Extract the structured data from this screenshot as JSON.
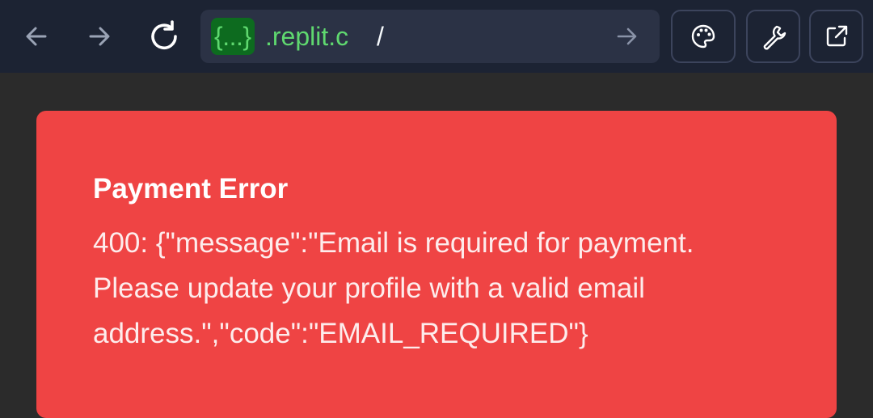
{
  "browser": {
    "url_badge": "{...}",
    "url_domain": ".replit.c",
    "url_path": "/",
    "icons": {
      "back": "arrow-left-icon",
      "forward": "arrow-right-icon",
      "reload": "reload-icon",
      "go": "arrow-right-icon",
      "theme": "palette-icon",
      "devtools": "wrench-icon",
      "open_external": "external-link-icon"
    }
  },
  "toast": {
    "title": "Payment Error",
    "message": "400: {\"message\":\"Email is required for payment. Please update your profile with a valid email address.\",\"code\":\"EMAIL_REQUIRED\"}"
  },
  "colors": {
    "topbar_bg": "#1c2333",
    "urlbar_bg": "#2b3245",
    "url_green": "#5fd86f",
    "error_bg": "#ef4444",
    "page_bg": "#2b2b2b"
  }
}
